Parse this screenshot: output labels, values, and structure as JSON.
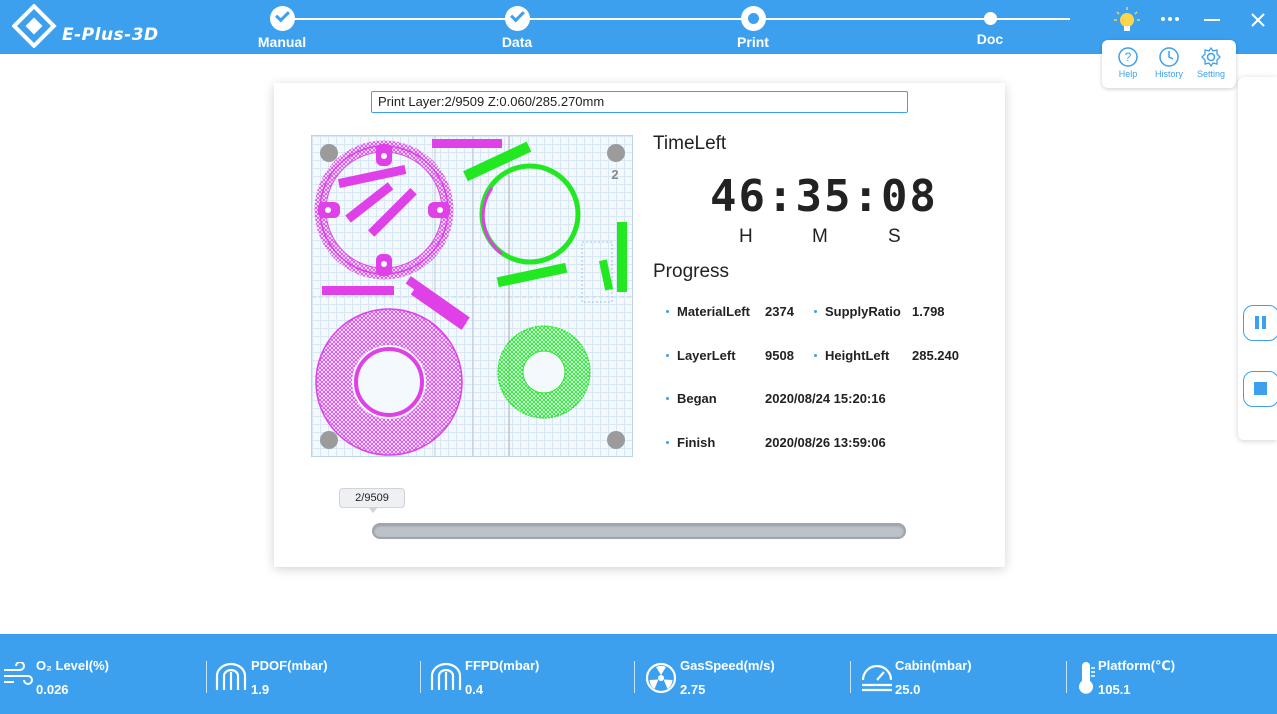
{
  "app": {
    "logo_text": "E-Plus-3D"
  },
  "steps": [
    {
      "label": "Manual",
      "state": "done"
    },
    {
      "label": "Data",
      "state": "done"
    },
    {
      "label": "Print",
      "state": "current"
    },
    {
      "label": "Doc",
      "state": "pending"
    }
  ],
  "menu": {
    "help": "Help",
    "history": "History",
    "setting": "Setting"
  },
  "print": {
    "layer_info": "Print Layer:2/9509 Z:0.060/285.270mm",
    "preview_number": "2",
    "timeleft_title": "TimeLeft",
    "time_value": "46:35:08",
    "unit_h": "H",
    "unit_m": "M",
    "unit_s": "S",
    "progress_title": "Progress",
    "stats": {
      "material_left_label": "MaterialLeft",
      "material_left_value": "2374",
      "supply_ratio_label": "SupplyRatio",
      "supply_ratio_value": "1.798",
      "layer_left_label": "LayerLeft",
      "layer_left_value": "9508",
      "height_left_label": "HeightLeft",
      "height_left_value": "285.240",
      "began_label": "Began",
      "began_value": "2020/08/24 15:20:16",
      "finish_label": "Finish",
      "finish_value": "2020/08/26 13:59:06"
    },
    "slider_label": "2/9509",
    "slider_current": 2,
    "slider_total": 9509
  },
  "sensors": [
    {
      "label": "O₂ Level(%)",
      "value": "0.026",
      "icon": "wind-icon"
    },
    {
      "label": "PDOF(mbar)",
      "value": "1.9",
      "icon": "filter-icon"
    },
    {
      "label": "FFPD(mbar)",
      "value": "0.4",
      "icon": "filter-icon"
    },
    {
      "label": "GasSpeed(m/s)",
      "value": "2.75",
      "icon": "fan-icon"
    },
    {
      "label": "Cabin(mbar)",
      "value": "25.0",
      "icon": "gauge-icon"
    },
    {
      "label": "Platform(℃)",
      "value": "105.1",
      "icon": "thermometer-icon"
    }
  ],
  "colors": {
    "accent": "#3ca0ef",
    "part_magenta": "#e040e8",
    "part_green": "#22e822"
  }
}
